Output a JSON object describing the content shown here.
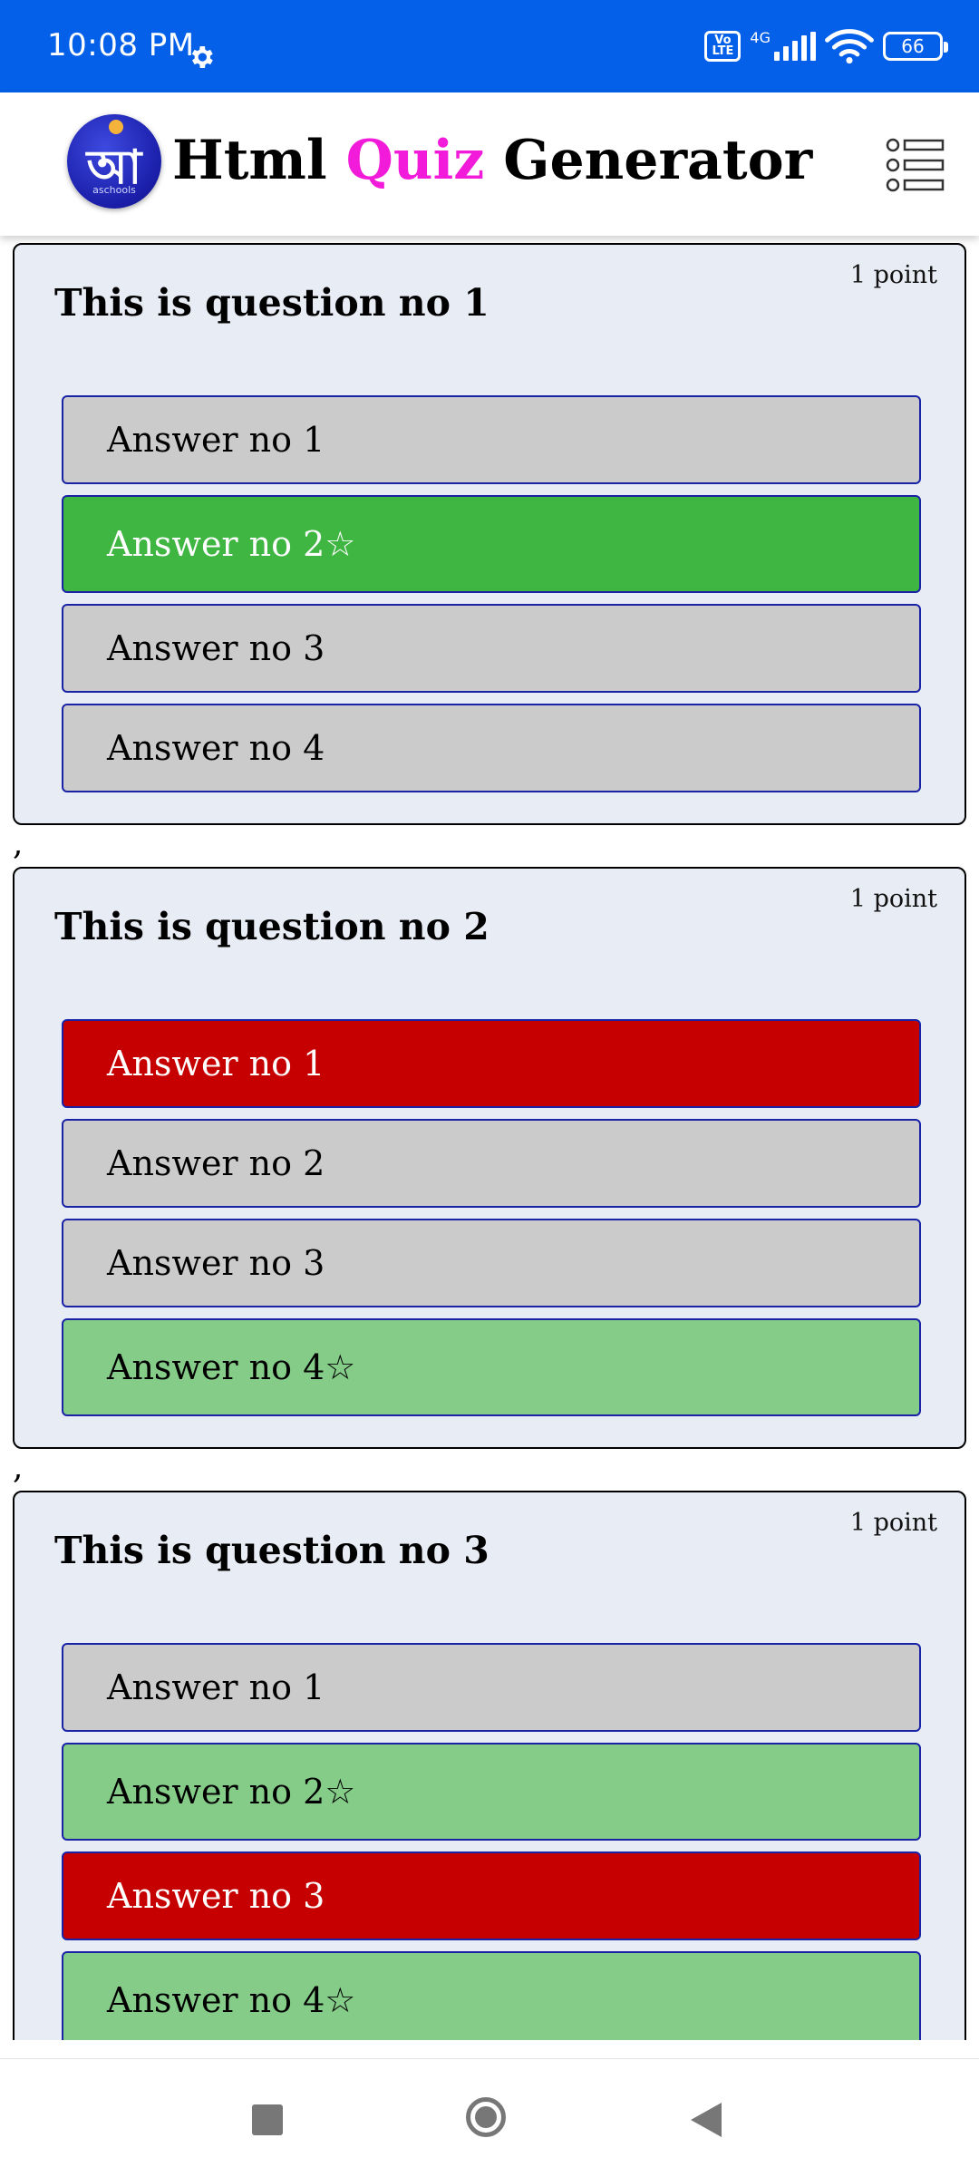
{
  "status_bar": {
    "time": "10:08 PM",
    "volte": "Vo LTE",
    "network": "4G",
    "battery": "66"
  },
  "header": {
    "logo_glyph": "আ",
    "logo_sub": "aschools",
    "title_part1": "Html",
    "title_accent": "Quiz",
    "title_part2": "Generator",
    "accent_color": "#f21bd9"
  },
  "questions": [
    {
      "points": "1 point",
      "text": "This is question no 1",
      "answers": [
        {
          "label": "Answer no 1",
          "state": "neutral"
        },
        {
          "label": "Answer no 2☆",
          "state": "correct-selected"
        },
        {
          "label": "Answer no 3",
          "state": "neutral"
        },
        {
          "label": "Answer no 4",
          "state": "neutral"
        }
      ]
    },
    {
      "points": "1 point",
      "text": "This is question no 2",
      "answers": [
        {
          "label": "Answer no 1",
          "state": "wrong"
        },
        {
          "label": "Answer no 2",
          "state": "neutral"
        },
        {
          "label": "Answer no 3",
          "state": "neutral"
        },
        {
          "label": "Answer no 4☆",
          "state": "correct"
        }
      ]
    },
    {
      "points": "1 point",
      "text": "This is question no 3",
      "answers": [
        {
          "label": "Answer no 1",
          "state": "neutral"
        },
        {
          "label": "Answer no 2☆",
          "state": "correct"
        },
        {
          "label": "Answer no 3",
          "state": "wrong"
        },
        {
          "label": "Answer no 4☆",
          "state": "correct"
        }
      ]
    }
  ],
  "separator": ",",
  "colors": {
    "status_bar": "#0460e8",
    "card_bg": "#e8ecf4",
    "neutral": "#cbcbcb",
    "correct_selected": "#3fb542",
    "correct": "#84cc88",
    "wrong": "#c60000"
  }
}
